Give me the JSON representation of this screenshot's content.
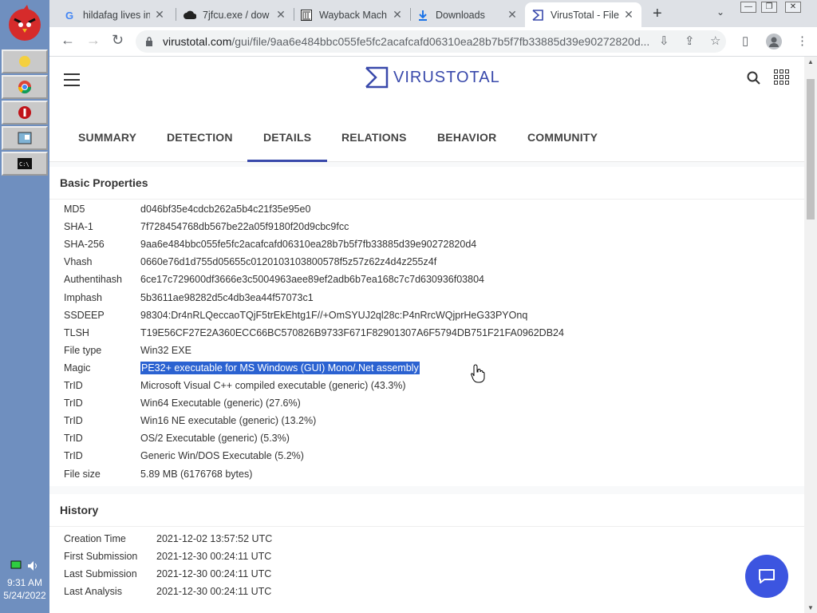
{
  "taskbar": {
    "time": "9:31 AM",
    "date": "5/24/2022"
  },
  "browser": {
    "tabs": [
      {
        "title": "hildafag lives in",
        "icon": "google-icon"
      },
      {
        "title": "7jfcu.exe / dow",
        "icon": "cloud-download-icon"
      },
      {
        "title": "Wayback Mach",
        "icon": "archive-icon"
      },
      {
        "title": "Downloads",
        "icon": "download-icon"
      },
      {
        "title": "VirusTotal - File",
        "icon": "virustotal-icon"
      }
    ],
    "url_host": "virustotal.com",
    "url_path": "/gui/file/9aa6e484bbc055fe5fc2acafcafd06310ea28b7b5f7fb33885d39e90272820d..."
  },
  "vt": {
    "brand": "VIRUSTOTAL",
    "tabs": [
      "SUMMARY",
      "DETECTION",
      "DETAILS",
      "RELATIONS",
      "BEHAVIOR",
      "COMMUNITY"
    ],
    "active_tab": "DETAILS",
    "colors": {
      "accent": "#3949ab",
      "selection": "#2b62d1",
      "chat": "#3c55e0"
    }
  },
  "basic": {
    "title": "Basic Properties",
    "rows": [
      {
        "k": "MD5",
        "v": "d046bf35e4cdcb262a5b4c21f35e95e0"
      },
      {
        "k": "SHA-1",
        "v": "7f728454768db567be22a05f9180f20d9cbc9fcc"
      },
      {
        "k": "SHA-256",
        "v": "9aa6e484bbc055fe5fc2acafcafd06310ea28b7b5f7fb33885d39e90272820d4"
      },
      {
        "k": "Vhash",
        "v": "0660e76d1d755d05655c0120103103800578f5z57z62z4d4z255z4f"
      },
      {
        "k": "Authentihash",
        "v": "6ce17c729600df3666e3c5004963aee89ef2adb6b7ea168c7c7d630936f03804"
      },
      {
        "k": "Imphash",
        "v": "5b3611ae98282d5c4db3ea44f57073c1"
      },
      {
        "k": "SSDEEP",
        "v": "98304:Dr4nRLQeccaoTQjF5trEkEhtg1F//+OmSYUJ2ql28c:P4nRrcWQjprHeG33PYOnq"
      },
      {
        "k": "TLSH",
        "v": "T19E56CF27E2A360ECC66BC570826B9733F671F82901307A6F5794DB751F21FA0962DB24"
      },
      {
        "k": "File type",
        "v": "Win32 EXE"
      },
      {
        "k": "Magic",
        "v": "PE32+ executable for MS Windows (GUI) Mono/.Net assembly"
      },
      {
        "k": "TrID",
        "v": "Microsoft Visual C++ compiled executable (generic) (43.3%)"
      },
      {
        "k": "TrID",
        "v": "Win64 Executable (generic) (27.6%)"
      },
      {
        "k": "TrID",
        "v": "Win16 NE executable (generic) (13.2%)"
      },
      {
        "k": "TrID",
        "v": "OS/2 Executable (generic) (5.3%)"
      },
      {
        "k": "TrID",
        "v": "Generic Win/DOS Executable (5.2%)"
      },
      {
        "k": "File size",
        "v": "5.89 MB (6176768 bytes)"
      }
    ]
  },
  "history": {
    "title": "History",
    "rows": [
      {
        "k": "Creation Time",
        "v": "2021-12-02 13:57:52 UTC"
      },
      {
        "k": "First Submission",
        "v": "2021-12-30 00:24:11 UTC"
      },
      {
        "k": "Last Submission",
        "v": "2021-12-30 00:24:11 UTC"
      },
      {
        "k": "Last Analysis",
        "v": "2021-12-30 00:24:11 UTC"
      }
    ]
  }
}
